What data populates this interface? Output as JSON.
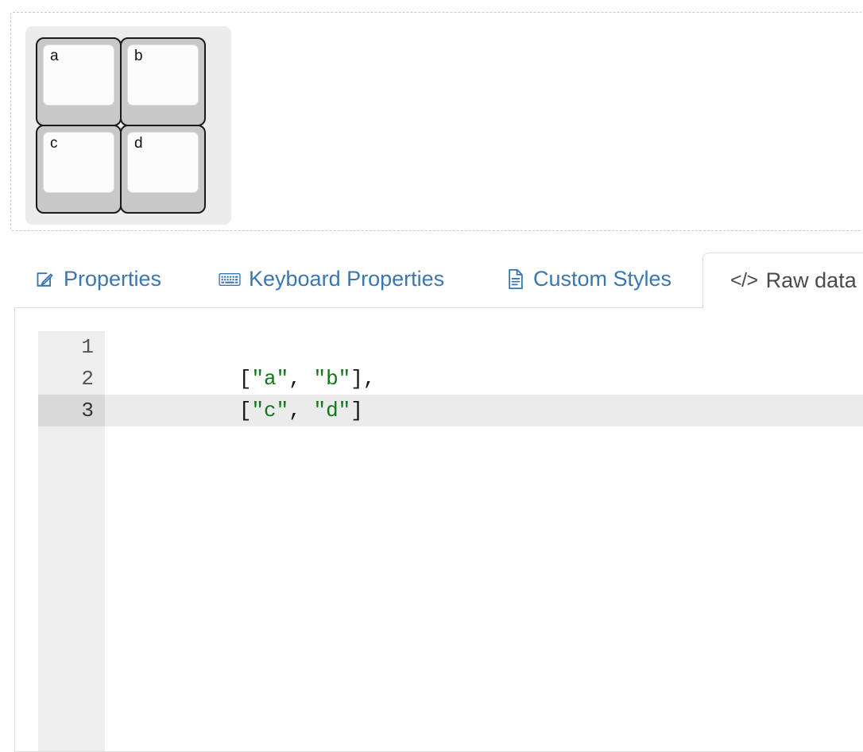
{
  "keyboard_preview": {
    "dropzone_name": "keyboard-dropzone",
    "rows": [
      [
        {
          "label": "a"
        },
        {
          "label": "b"
        }
      ],
      [
        {
          "label": "c"
        },
        {
          "label": "d"
        }
      ]
    ]
  },
  "tabs": [
    {
      "label": "Properties",
      "icon": "edit-square-icon",
      "active": false
    },
    {
      "label": "Keyboard Properties",
      "icon": "keyboard-icon",
      "active": false
    },
    {
      "label": "Custom Styles",
      "icon": "document-icon",
      "active": false
    },
    {
      "label": "Raw data",
      "icon": "code-icon",
      "icon_text": "</>",
      "active": true
    }
  ],
  "editor": {
    "lines": [
      {
        "number": "1",
        "active": false,
        "tokens": [
          {
            "text": "[",
            "type": "punc"
          },
          {
            "text": "\"a\"",
            "type": "str"
          },
          {
            "text": ", ",
            "type": "punc"
          },
          {
            "text": "\"b\"",
            "type": "str"
          },
          {
            "text": "],",
            "type": "punc"
          }
        ]
      },
      {
        "number": "2",
        "active": false,
        "tokens": [
          {
            "text": "[",
            "type": "punc"
          },
          {
            "text": "\"c\"",
            "type": "str"
          },
          {
            "text": ", ",
            "type": "punc"
          },
          {
            "text": "\"d\"",
            "type": "str"
          },
          {
            "text": "]",
            "type": "punc"
          }
        ]
      },
      {
        "number": "3",
        "active": true,
        "tokens": []
      }
    ]
  },
  "colors": {
    "tab_link": "#3b76b0",
    "tab_active_text": "#4a4a4a",
    "string_token": "#0e7a16",
    "punct_token": "#141414",
    "key_body": "#c8c8c8",
    "key_face": "#fcfcfc",
    "keyboard_bg": "#ececec",
    "panel_border": "#dddddd",
    "gutter_bg": "#eeeeee",
    "active_line_bg": "#ebebeb"
  }
}
